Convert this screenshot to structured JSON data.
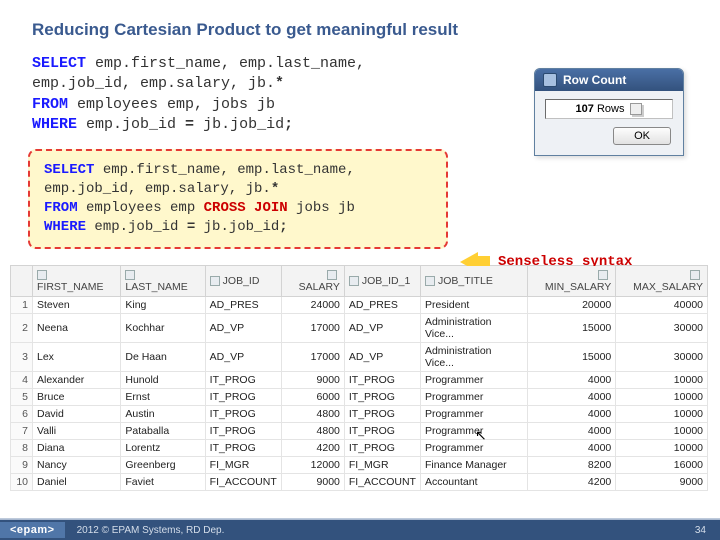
{
  "title": "Reducing Cartesian Product to get meaningful result",
  "sql1": {
    "l1a": "SELECT",
    "l1b": " emp.first_name,  emp.last_name,",
    "l2": "  emp.job_id, emp.salary, jb.",
    "l2star": "*",
    "l3a": "FROM",
    "l3b": " employees emp, jobs jb",
    "l4a": "WHERE",
    "l4b": " emp.job_id ",
    "l4eq": "=",
    "l4c": " jb.job_id",
    "l4semi": ";"
  },
  "sql2": {
    "l1a": "SELECT",
    "l1b": " emp.first_name, emp.last_name,",
    "l2": "  emp.job_id, emp.salary, jb.",
    "l2star": "*",
    "l3a": "FROM",
    "l3b": " employees emp ",
    "l3cross": "CROSS JOIN",
    "l3c": " jobs jb",
    "l4a": "WHERE",
    "l4b": " emp.job_id ",
    "l4eq": "=",
    "l4c": " jb.job_id",
    "l4semi": ";"
  },
  "senseless": "Senseless syntax",
  "rowcount": {
    "title": "Row Count",
    "rows_n": "107",
    "rows_t": " Rows",
    "ok": "OK"
  },
  "cols": {
    "c0": "FIRST_NAME",
    "c1": "LAST_NAME",
    "c2": "JOB_ID",
    "c3": "SALARY",
    "c4": "JOB_ID_1",
    "c5": "JOB_TITLE",
    "c6": "MIN_SALARY",
    "c7": "MAX_SALARY"
  },
  "rows": [
    {
      "i": "1",
      "fn": "Steven",
      "ln": "King",
      "jid": "AD_PRES",
      "sal": "24000",
      "jid1": "AD_PRES",
      "jt": "President",
      "min": "20000",
      "max": "40000"
    },
    {
      "i": "2",
      "fn": "Neena",
      "ln": "Kochhar",
      "jid": "AD_VP",
      "sal": "17000",
      "jid1": "AD_VP",
      "jt": "Administration Vice...",
      "min": "15000",
      "max": "30000"
    },
    {
      "i": "3",
      "fn": "Lex",
      "ln": "De Haan",
      "jid": "AD_VP",
      "sal": "17000",
      "jid1": "AD_VP",
      "jt": "Administration Vice...",
      "min": "15000",
      "max": "30000"
    },
    {
      "i": "4",
      "fn": "Alexander",
      "ln": "Hunold",
      "jid": "IT_PROG",
      "sal": "9000",
      "jid1": "IT_PROG",
      "jt": "Programmer",
      "min": "4000",
      "max": "10000"
    },
    {
      "i": "5",
      "fn": "Bruce",
      "ln": "Ernst",
      "jid": "IT_PROG",
      "sal": "6000",
      "jid1": "IT_PROG",
      "jt": "Programmer",
      "min": "4000",
      "max": "10000"
    },
    {
      "i": "6",
      "fn": "David",
      "ln": "Austin",
      "jid": "IT_PROG",
      "sal": "4800",
      "jid1": "IT_PROG",
      "jt": "Programmer",
      "min": "4000",
      "max": "10000"
    },
    {
      "i": "7",
      "fn": "Valli",
      "ln": "Pataballa",
      "jid": "IT_PROG",
      "sal": "4800",
      "jid1": "IT_PROG",
      "jt": "Programmer",
      "min": "4000",
      "max": "10000"
    },
    {
      "i": "8",
      "fn": "Diana",
      "ln": "Lorentz",
      "jid": "IT_PROG",
      "sal": "4200",
      "jid1": "IT_PROG",
      "jt": "Programmer",
      "min": "4000",
      "max": "10000"
    },
    {
      "i": "9",
      "fn": "Nancy",
      "ln": "Greenberg",
      "jid": "FI_MGR",
      "sal": "12000",
      "jid1": "FI_MGR",
      "jt": "Finance Manager",
      "min": "8200",
      "max": "16000"
    },
    {
      "i": "10",
      "fn": "Daniel",
      "ln": "Faviet",
      "jid": "FI_ACCOUNT",
      "sal": "9000",
      "jid1": "FI_ACCOUNT",
      "jt": "Accountant",
      "min": "4200",
      "max": "9000"
    }
  ],
  "footer": {
    "logo": "<epam>",
    "copy": "2012 © EPAM Systems, RD Dep.",
    "page": "34"
  }
}
